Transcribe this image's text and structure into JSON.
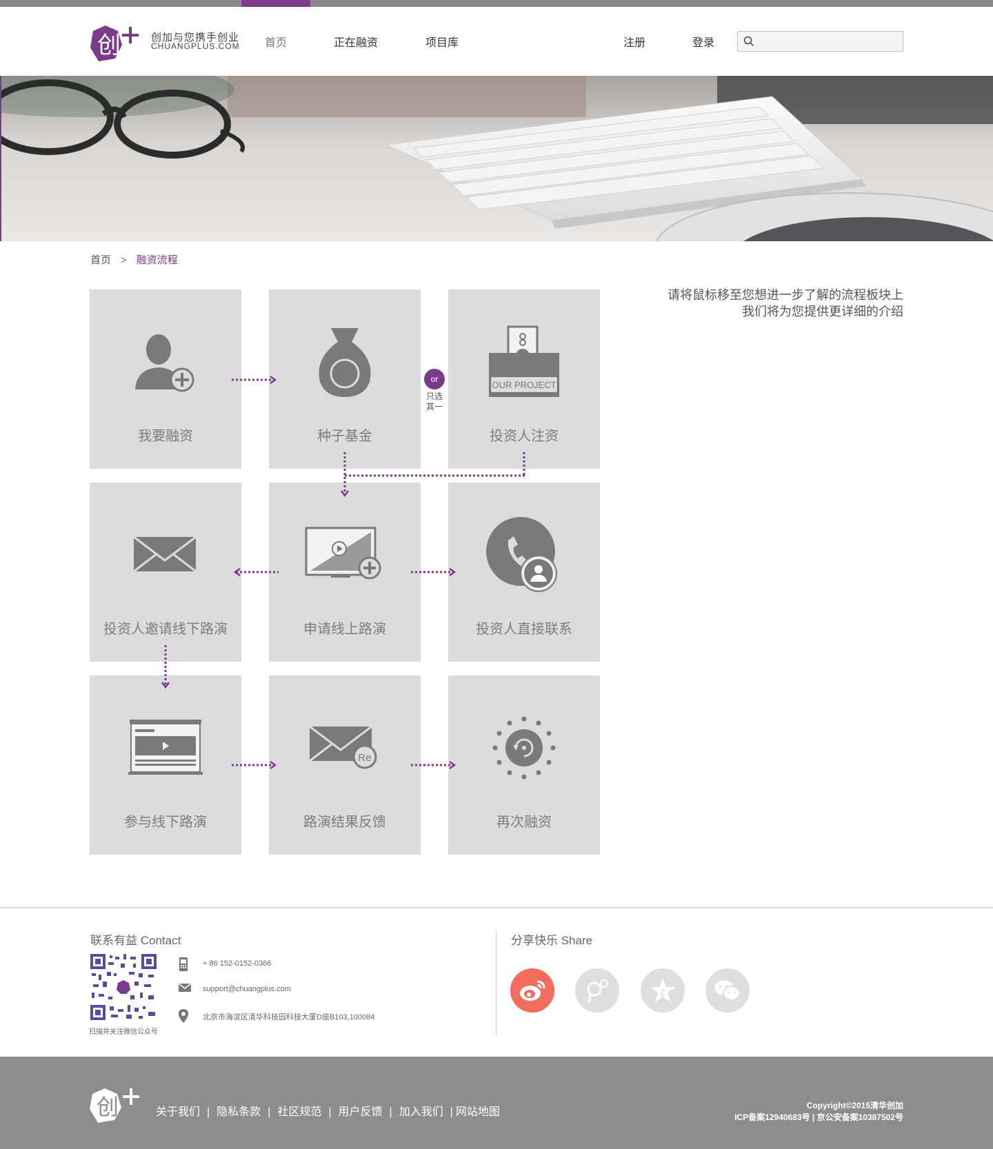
{
  "site": {
    "logo_cn": "创加与您携手创业",
    "logo_en": "CHUANGPLUS.COM"
  },
  "nav": {
    "home": "首页",
    "financing": "正在融资",
    "projects": "项目库",
    "register": "注册",
    "login": "登录",
    "search_placeholder": ""
  },
  "breadcrumb": {
    "home": "首页",
    "separator": ">",
    "current": "融资流程"
  },
  "tip": {
    "line1": "请将鼠标移至您想进一步了解的流程板块上",
    "line2": "我们将为您提供更详细的介绍"
  },
  "flow": {
    "or_badge": "or",
    "or_note_1": "只选",
    "or_note_2": "其一",
    "our_project": "OUR PROJECT",
    "tiles": [
      {
        "label": "我要融资",
        "icon": "user-add-icon"
      },
      {
        "label": "种子基金",
        "icon": "money-bag-icon"
      },
      {
        "label": "投资人注资",
        "icon": "ballot-box-icon"
      },
      {
        "label": "投资人邀请线下路演",
        "icon": "envelope-icon"
      },
      {
        "label": "申请线上路演",
        "icon": "monitor-play-icon"
      },
      {
        "label": "投资人直接联系",
        "icon": "phone-contact-icon"
      },
      {
        "label": "参与线下路演",
        "icon": "video-window-icon"
      },
      {
        "label": "路演结果反馈",
        "icon": "reply-mail-icon"
      },
      {
        "label": "再次融资",
        "icon": "refresh-cycle-icon"
      }
    ]
  },
  "contact": {
    "title": "联系有益 Contact",
    "qr_caption": "扫描并关注微信公众号",
    "phone": "+ 86 152-0152-0366",
    "email": "support@chuangplus.com",
    "address": "北京市海淀区清华科技园科技大厦D座B103,100084"
  },
  "share": {
    "title": "分享快乐 Share",
    "buttons": [
      "weibo-icon",
      "tencent-weibo-icon",
      "qzone-icon",
      "wechat-icon"
    ]
  },
  "footer": {
    "links": [
      "关于我们",
      "隐私条款",
      "社区规范",
      "用户反馈",
      "加入我们",
      "网站地图"
    ],
    "copyright": "Copyright©2015清华创加",
    "icp": "ICP备案12940683号 | 京公安备案10387502号"
  },
  "colors": {
    "accent": "#7a3c8a",
    "tile": "#dcdcdc",
    "icon": "#7a7a7a",
    "footer": "#8d8d8d",
    "weibo": "#f26b5b"
  }
}
